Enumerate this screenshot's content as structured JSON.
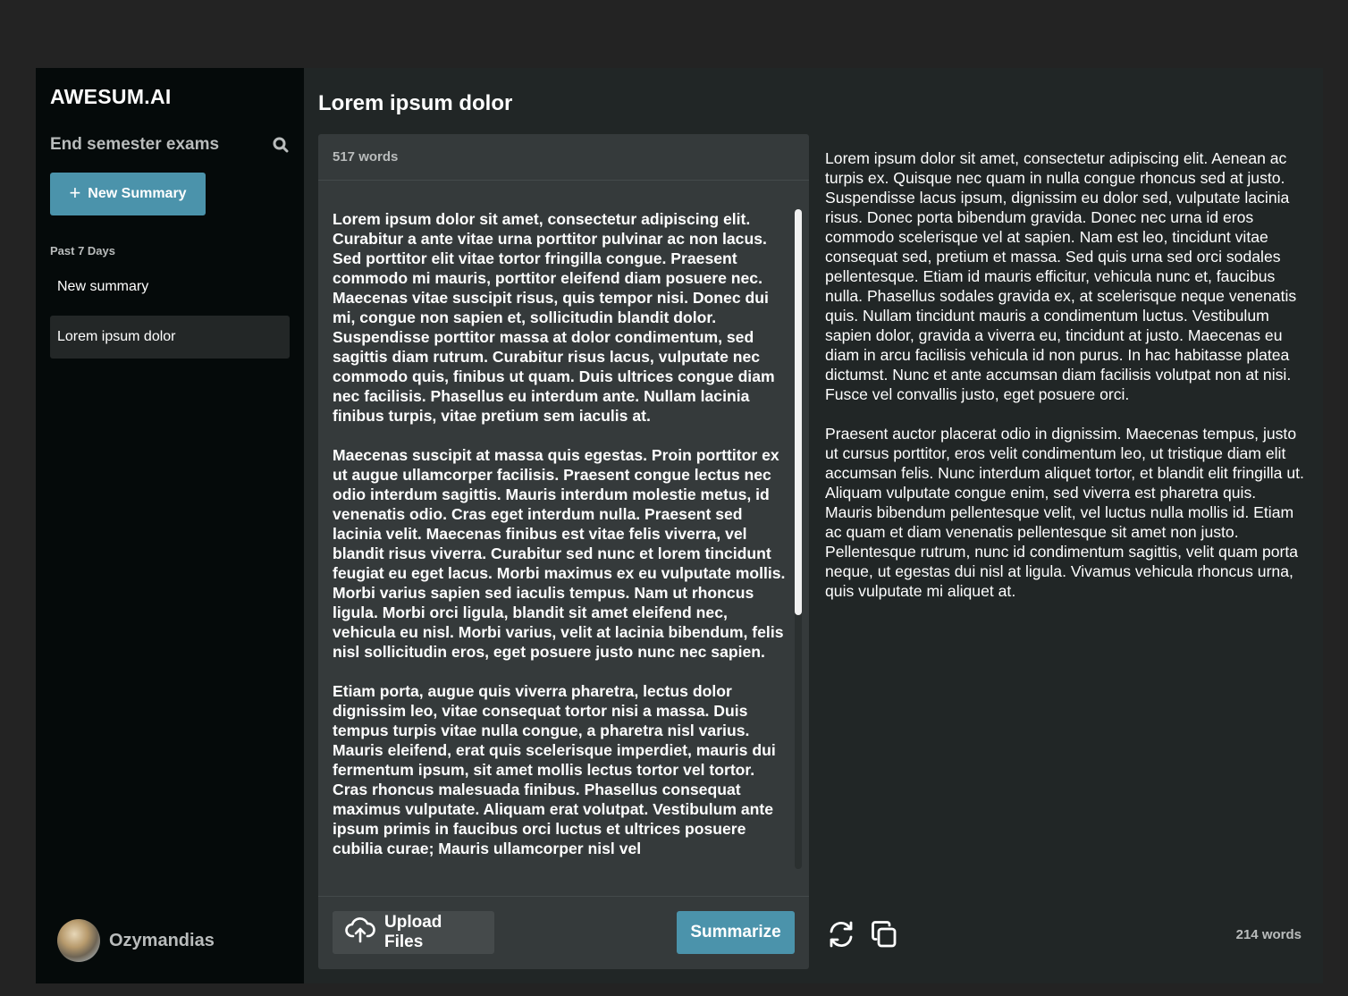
{
  "brand": "AWESUM.AI",
  "sidebar": {
    "search_title": "End semester exams",
    "new_button_label": "New Summary",
    "section_label": "Past 7 Days",
    "items": [
      {
        "label": "New summary"
      },
      {
        "label": "Lorem ipsum dolor"
      }
    ],
    "user_name": "Ozymandias"
  },
  "main": {
    "title": "Lorem ipsum dolor",
    "input": {
      "word_count": "517 words",
      "paragraphs": [
        "Lorem ipsum dolor sit amet, consectetur adipiscing elit. Curabitur a ante vitae urna porttitor pulvinar ac non lacus. Sed porttitor elit vitae tortor fringilla congue. Praesent commodo mi mauris, porttitor eleifend diam posuere nec. Maecenas vitae suscipit risus, quis tempor nisi. Donec dui mi, congue non sapien et, sollicitudin blandit dolor. Suspendisse porttitor massa at dolor condimentum, sed sagittis diam rutrum. Curabitur risus lacus, vulputate nec commodo quis, finibus ut quam. Duis ultrices congue diam nec facilisis. Phasellus eu interdum ante. Nullam lacinia finibus turpis, vitae pretium sem iaculis at.",
        "Maecenas suscipit at massa quis egestas. Proin porttitor ex ut augue ullamcorper facilisis. Praesent congue lectus nec odio interdum sagittis. Mauris interdum molestie metus, id venenatis odio. Cras eget interdum nulla. Praesent sed lacinia velit. Maecenas finibus est vitae felis viverra, vel blandit risus viverra. Curabitur sed nunc et lorem tincidunt feugiat eu eget lacus. Morbi maximus ex eu vulputate mollis. Morbi varius sapien sed iaculis tempus. Nam ut rhoncus ligula. Morbi orci ligula, blandit sit amet eleifend nec, vehicula eu nisl. Morbi varius, velit at lacinia bibendum, felis nisl sollicitudin eros, eget posuere justo nunc nec sapien.",
        "Etiam porta, augue quis viverra pharetra, lectus dolor dignissim leo, vitae consequat tortor nisi a massa. Duis tempus turpis vitae nulla congue, a pharetra nisl varius. Mauris eleifend, erat quis scelerisque imperdiet, mauris dui fermentum ipsum, sit amet mollis lectus tortor vel tortor. Cras rhoncus malesuada finibus. Phasellus consequat maximus vulputate. Aliquam erat volutpat. Vestibulum ante ipsum primis in faucibus orci luctus et ultrices posuere cubilia curae; Mauris ullamcorper nisl vel"
      ],
      "upload_label": "Upload Files",
      "summarize_label": "Summarize"
    },
    "output": {
      "paragraphs": [
        "Lorem ipsum dolor sit amet, consectetur adipiscing elit. Aenean ac turpis ex. Quisque nec quam in nulla congue rhoncus sed at justo. Suspendisse lacus ipsum, dignissim eu dolor sed, vulputate lacinia risus. Donec porta bibendum gravida. Donec nec urna id eros commodo scelerisque vel at sapien. Nam est leo, tincidunt vitae consequat sed, pretium et massa. Sed quis urna sed orci sodales pellentesque. Etiam id mauris efficitur, vehicula nunc et, faucibus nulla. Phasellus sodales gravida ex, at scelerisque neque venenatis quis. Nullam tincidunt mauris a condimentum luctus. Vestibulum sapien dolor, gravida a viverra eu, tincidunt at justo. Maecenas eu diam in arcu facilisis vehicula id non purus. In hac habitasse platea dictumst. Nunc et ante accumsan diam facilisis volutpat non at nisi. Fusce vel convallis justo, eget posuere orci.",
        "Praesent auctor placerat odio in dignissim. Maecenas tempus, justo ut cursus porttitor, eros velit condimentum leo, ut tristique diam elit accumsan felis. Nunc interdum aliquet tortor, et blandit elit fringilla ut. Aliquam vulputate congue enim, sed viverra est pharetra quis. Mauris bibendum pellentesque velit, vel luctus nulla mollis id. Etiam ac quam et diam venenatis pellentesque sit amet non justo. Pellentesque rutrum, nunc id condimentum sagittis, velit quam porta neque, ut egestas dui nisl at ligula. Vivamus vehicula rhoncus urna, quis vulputate mi aliquet at."
      ],
      "word_count": "214 words"
    }
  },
  "icons": {
    "search": "search-icon",
    "plus": "plus-icon",
    "upload": "cloud-upload-icon",
    "refresh": "refresh-icon",
    "copy": "copy-icon"
  },
  "colors": {
    "accent": "#4b93ab",
    "sidebar_bg": "#050a0a",
    "main_bg": "#212626",
    "panel_bg": "#353a3b",
    "muted_text": "#b9bcbc"
  }
}
